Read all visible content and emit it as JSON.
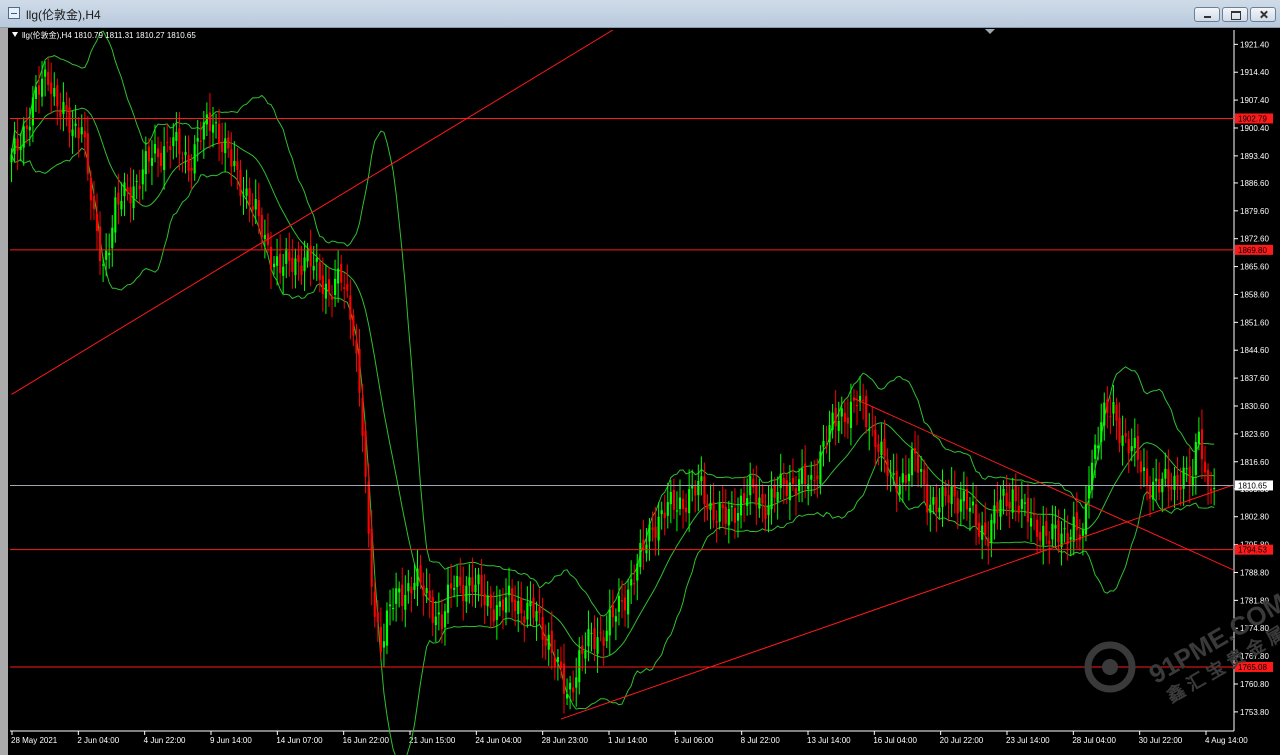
{
  "window": {
    "title": "llg(伦敦金),H4",
    "buttons": {
      "minimize": "minimize",
      "maximize": "maximize",
      "close": "close"
    }
  },
  "header": {
    "symbol": "llg(伦敦金),H4",
    "ohlc": "1810.79 1811.31 1810.27 1810.65"
  },
  "colors": {
    "background": "#000000",
    "bull": "#00ff00",
    "bear": "#ff0000",
    "band": "#2fbf2f",
    "hline": "#ff1a1a",
    "priceline": "#9aa7b4"
  },
  "chart_data": {
    "type": "candlestick",
    "y_ticks": [
      "1921.40",
      "1914.40",
      "1907.40",
      "1900.40",
      "1893.40",
      "1886.60",
      "1879.60",
      "1872.60",
      "1865.60",
      "1858.60",
      "1851.60",
      "1844.60",
      "1837.60",
      "1830.60",
      "1823.60",
      "1816.60",
      "1809.80",
      "1802.80",
      "1795.80",
      "1788.80",
      "1781.80",
      "1774.80",
      "1767.80",
      "1760.80",
      "1753.80"
    ],
    "x_ticks": [
      "28 May 2021",
      "2 Jun 04:00",
      "4 Jun 22:00",
      "9 Jun 14:00",
      "14 Jun 07:00",
      "16 Jun 22:00",
      "21 Jun 15:00",
      "24 Jun 04:00",
      "28 Jun 23:00",
      "1 Jul 14:00",
      "6 Jul 06:00",
      "8 Jul 22:00",
      "13 Jul 14:00",
      "16 Jul 04:00",
      "20 Jul 22:00",
      "23 Jul 14:00",
      "28 Jul 04:00",
      "30 Jul 22:00",
      "4 Aug 14:00"
    ],
    "ylim": [
      1749,
      1925
    ],
    "horizontal_levels": [
      {
        "price": 1902.79,
        "label": "1902.79"
      },
      {
        "price": 1869.8,
        "label": "1869.80"
      },
      {
        "price": 1794.53,
        "label": "1794.53"
      },
      {
        "price": 1765.08,
        "label": "1765.08"
      }
    ],
    "current_price": {
      "price": 1810.65,
      "label": "1810.65"
    },
    "trendlines": [
      {
        "from": [
          0,
          1833.5
        ],
        "to": [
          197,
          1925
        ]
      },
      {
        "from": [
          180,
          1752
        ],
        "to": [
          491,
          1835
        ]
      },
      {
        "from": [
          276,
          1832.5
        ],
        "to": [
          491,
          1758
        ]
      }
    ],
    "anchors": [
      [
        0,
        1892
      ],
      [
        8,
        1908
      ],
      [
        12,
        1914
      ],
      [
        16,
        1905
      ],
      [
        20,
        1899
      ],
      [
        23,
        1903
      ],
      [
        27,
        1876
      ],
      [
        30,
        1866
      ],
      [
        34,
        1880
      ],
      [
        40,
        1886
      ],
      [
        46,
        1893
      ],
      [
        52,
        1897
      ],
      [
        58,
        1892
      ],
      [
        62,
        1898
      ],
      [
        66,
        1903
      ],
      [
        70,
        1895
      ],
      [
        74,
        1888
      ],
      [
        78,
        1883
      ],
      [
        83,
        1872
      ],
      [
        88,
        1865
      ],
      [
        93,
        1867
      ],
      [
        96,
        1868
      ],
      [
        100,
        1864
      ],
      [
        104,
        1860
      ],
      [
        108,
        1862
      ],
      [
        112,
        1852
      ],
      [
        115,
        1825
      ],
      [
        117,
        1795
      ],
      [
        119,
        1778
      ],
      [
        121,
        1772
      ],
      [
        124,
        1780
      ],
      [
        128,
        1783
      ],
      [
        132,
        1788
      ],
      [
        136,
        1782
      ],
      [
        141,
        1777
      ],
      [
        145,
        1786
      ],
      [
        150,
        1786
      ],
      [
        156,
        1782
      ],
      [
        160,
        1779
      ],
      [
        164,
        1783
      ],
      [
        168,
        1779
      ],
      [
        172,
        1778
      ],
      [
        176,
        1772
      ],
      [
        179,
        1764
      ],
      [
        182,
        1758
      ],
      [
        186,
        1767
      ],
      [
        190,
        1772
      ],
      [
        194,
        1774
      ],
      [
        198,
        1778
      ],
      [
        202,
        1785
      ],
      [
        206,
        1792
      ],
      [
        210,
        1801
      ],
      [
        214,
        1804
      ],
      [
        218,
        1806
      ],
      [
        222,
        1808
      ],
      [
        226,
        1810
      ],
      [
        230,
        1804
      ],
      [
        234,
        1802
      ],
      [
        238,
        1806
      ],
      [
        242,
        1809
      ],
      [
        246,
        1806
      ],
      [
        250,
        1808
      ],
      [
        254,
        1811
      ],
      [
        258,
        1812
      ],
      [
        262,
        1810
      ],
      [
        266,
        1822
      ],
      [
        270,
        1826
      ],
      [
        274,
        1830
      ],
      [
        277,
        1832
      ],
      [
        280,
        1827
      ],
      [
        284,
        1822
      ],
      [
        288,
        1811
      ],
      [
        292,
        1813
      ],
      [
        296,
        1817
      ],
      [
        300,
        1808
      ],
      [
        304,
        1805
      ],
      [
        308,
        1809
      ],
      [
        312,
        1807
      ],
      [
        316,
        1801
      ],
      [
        320,
        1799
      ],
      [
        324,
        1806
      ],
      [
        328,
        1809
      ],
      [
        332,
        1803
      ],
      [
        336,
        1801
      ],
      [
        340,
        1797
      ],
      [
        344,
        1799
      ],
      [
        348,
        1800
      ],
      [
        351,
        1796
      ],
      [
        353,
        1814
      ],
      [
        357,
        1827
      ],
      [
        361,
        1829
      ],
      [
        365,
        1822
      ],
      [
        369,
        1817
      ],
      [
        372,
        1812
      ],
      [
        376,
        1810
      ],
      [
        380,
        1812
      ],
      [
        384,
        1813
      ],
      [
        387,
        1811
      ],
      [
        389,
        1827
      ],
      [
        391,
        1813
      ],
      [
        394,
        1810
      ]
    ]
  }
}
